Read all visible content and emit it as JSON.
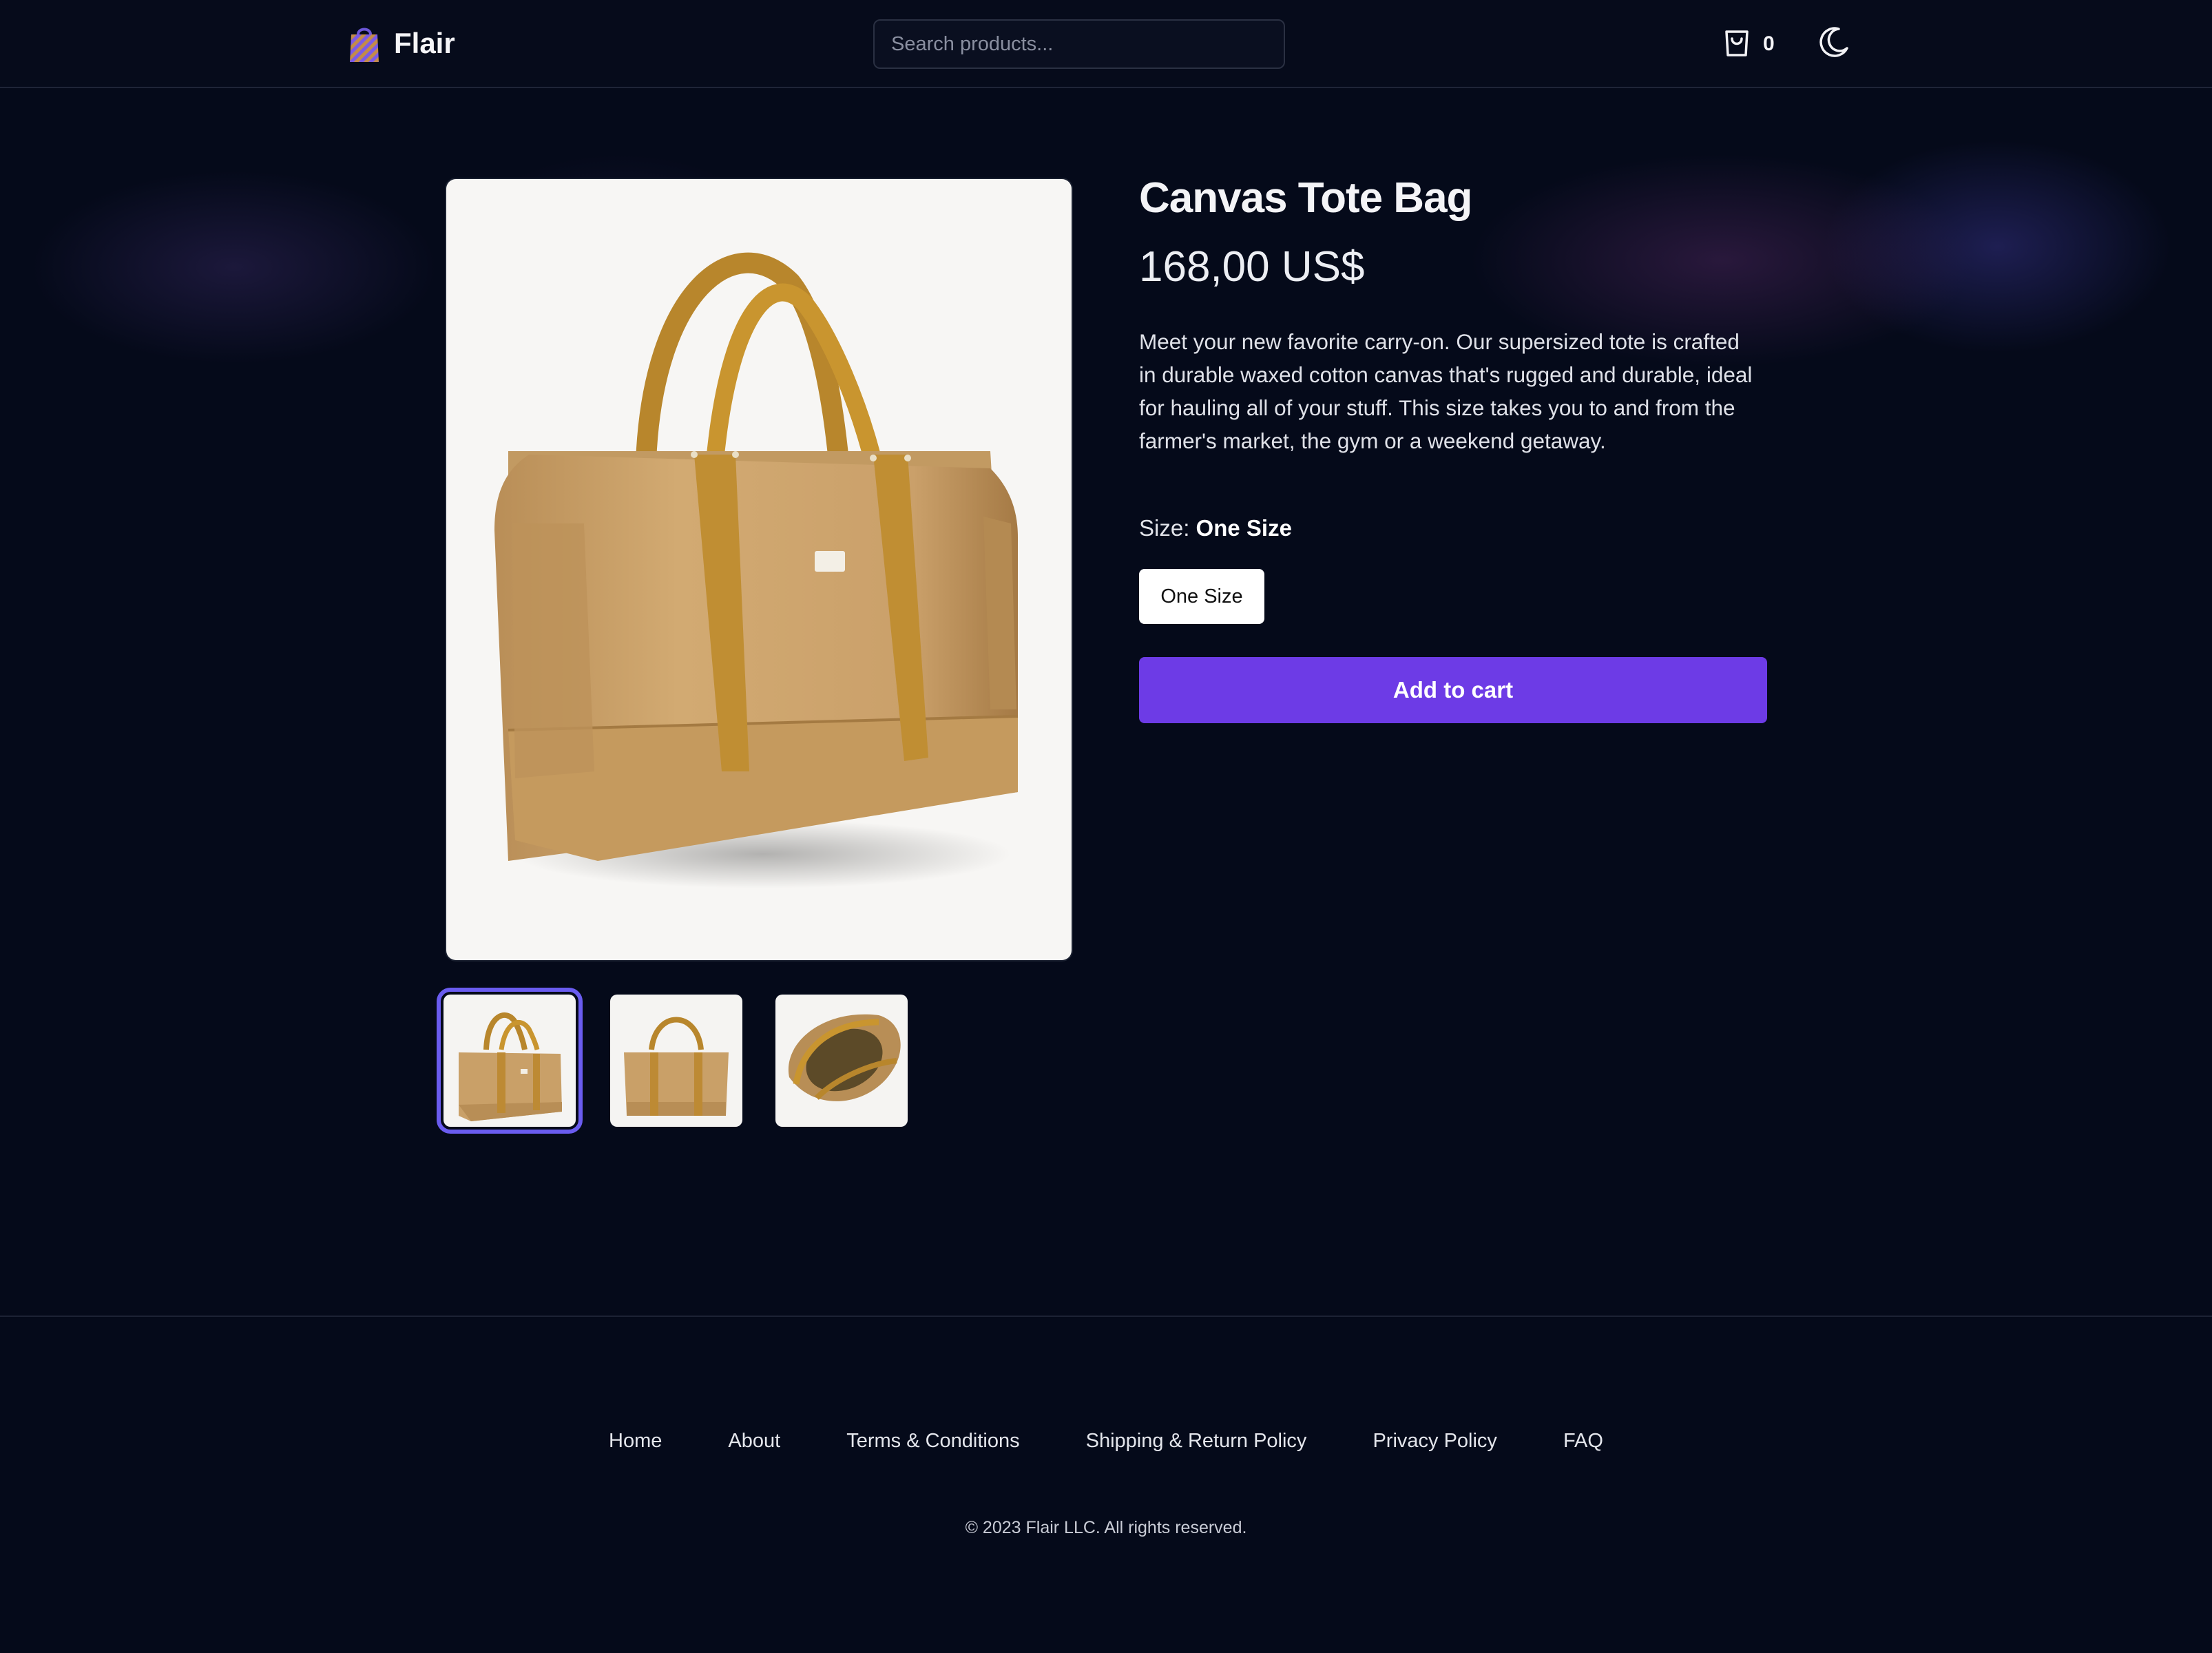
{
  "header": {
    "brand": "Flair",
    "search_placeholder": "Search products...",
    "cart_count": "0"
  },
  "product": {
    "title": "Canvas Tote Bag",
    "price": "168,00 US$",
    "description": "Meet your new favorite carry-on. Our supersized tote is crafted in durable waxed cotton canvas that's rugged and durable, ideal for hauling all of your stuff. This size takes you to and from the farmer's market, the gym or a weekend getaway.",
    "size_label": "Size:",
    "selected_size": "One Size",
    "size_options": [
      "One Size"
    ],
    "add_to_cart": "Add to cart",
    "images": [
      "tote-front",
      "tote-side",
      "tote-open"
    ],
    "active_image": 0
  },
  "footer": {
    "links": [
      "Home",
      "About",
      "Terms & Conditions",
      "Shipping & Return Policy",
      "Privacy Policy",
      "FAQ"
    ],
    "copyright": "© 2023 Flair LLC. All rights reserved."
  },
  "colors": {
    "background": "#050a1a",
    "accent": "#6d3be6",
    "thumb_active_ring": "#6a5cf0",
    "bag": "#c9a068",
    "strap": "#b8862c"
  },
  "icons": [
    "shopping-bag-logo-icon",
    "cart-icon",
    "moon-icon"
  ]
}
